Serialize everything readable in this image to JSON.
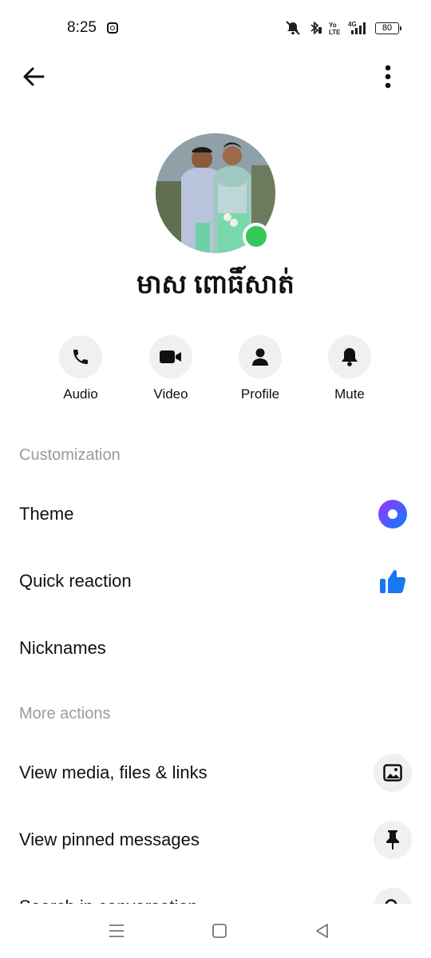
{
  "status_bar": {
    "time": "8:25",
    "battery": "80",
    "icons": [
      "instagram-icon",
      "mute-icon",
      "bluetooth-icon",
      "volte-icon",
      "signal-4g-icon",
      "battery-icon"
    ]
  },
  "header": {
    "back_icon": "arrow-left-icon",
    "menu_icon": "more-vertical-icon"
  },
  "profile": {
    "name": "មាស ពោធិ៍សាត់",
    "online_color": "#34c759"
  },
  "actions": [
    {
      "label": "Audio",
      "icon": "phone-icon"
    },
    {
      "label": "Video",
      "icon": "video-camera-icon"
    },
    {
      "label": "Profile",
      "icon": "person-icon"
    },
    {
      "label": "Mute",
      "icon": "bell-icon"
    }
  ],
  "customization": {
    "title": "Customization",
    "items": [
      {
        "label": "Theme",
        "icon": "theme-circle-icon"
      },
      {
        "label": "Quick reaction",
        "icon": "thumbs-up-icon"
      },
      {
        "label": "Nicknames"
      }
    ]
  },
  "more_actions": {
    "title": "More actions",
    "items": [
      {
        "label": "View media, files & links",
        "icon": "image-icon"
      },
      {
        "label": "View pinned messages",
        "icon": "pin-icon"
      },
      {
        "label": "Search in conversation",
        "icon": "search-icon"
      }
    ]
  },
  "nav_bar": {
    "icons": [
      "menu-icon",
      "home-square-icon",
      "back-triangle-icon"
    ]
  },
  "colors": {
    "accent_blue": "#1877f2",
    "section_grey": "#9b9b9b",
    "theme_gradient_start": "#a033ff",
    "theme_gradient_end": "#0a7cff"
  }
}
